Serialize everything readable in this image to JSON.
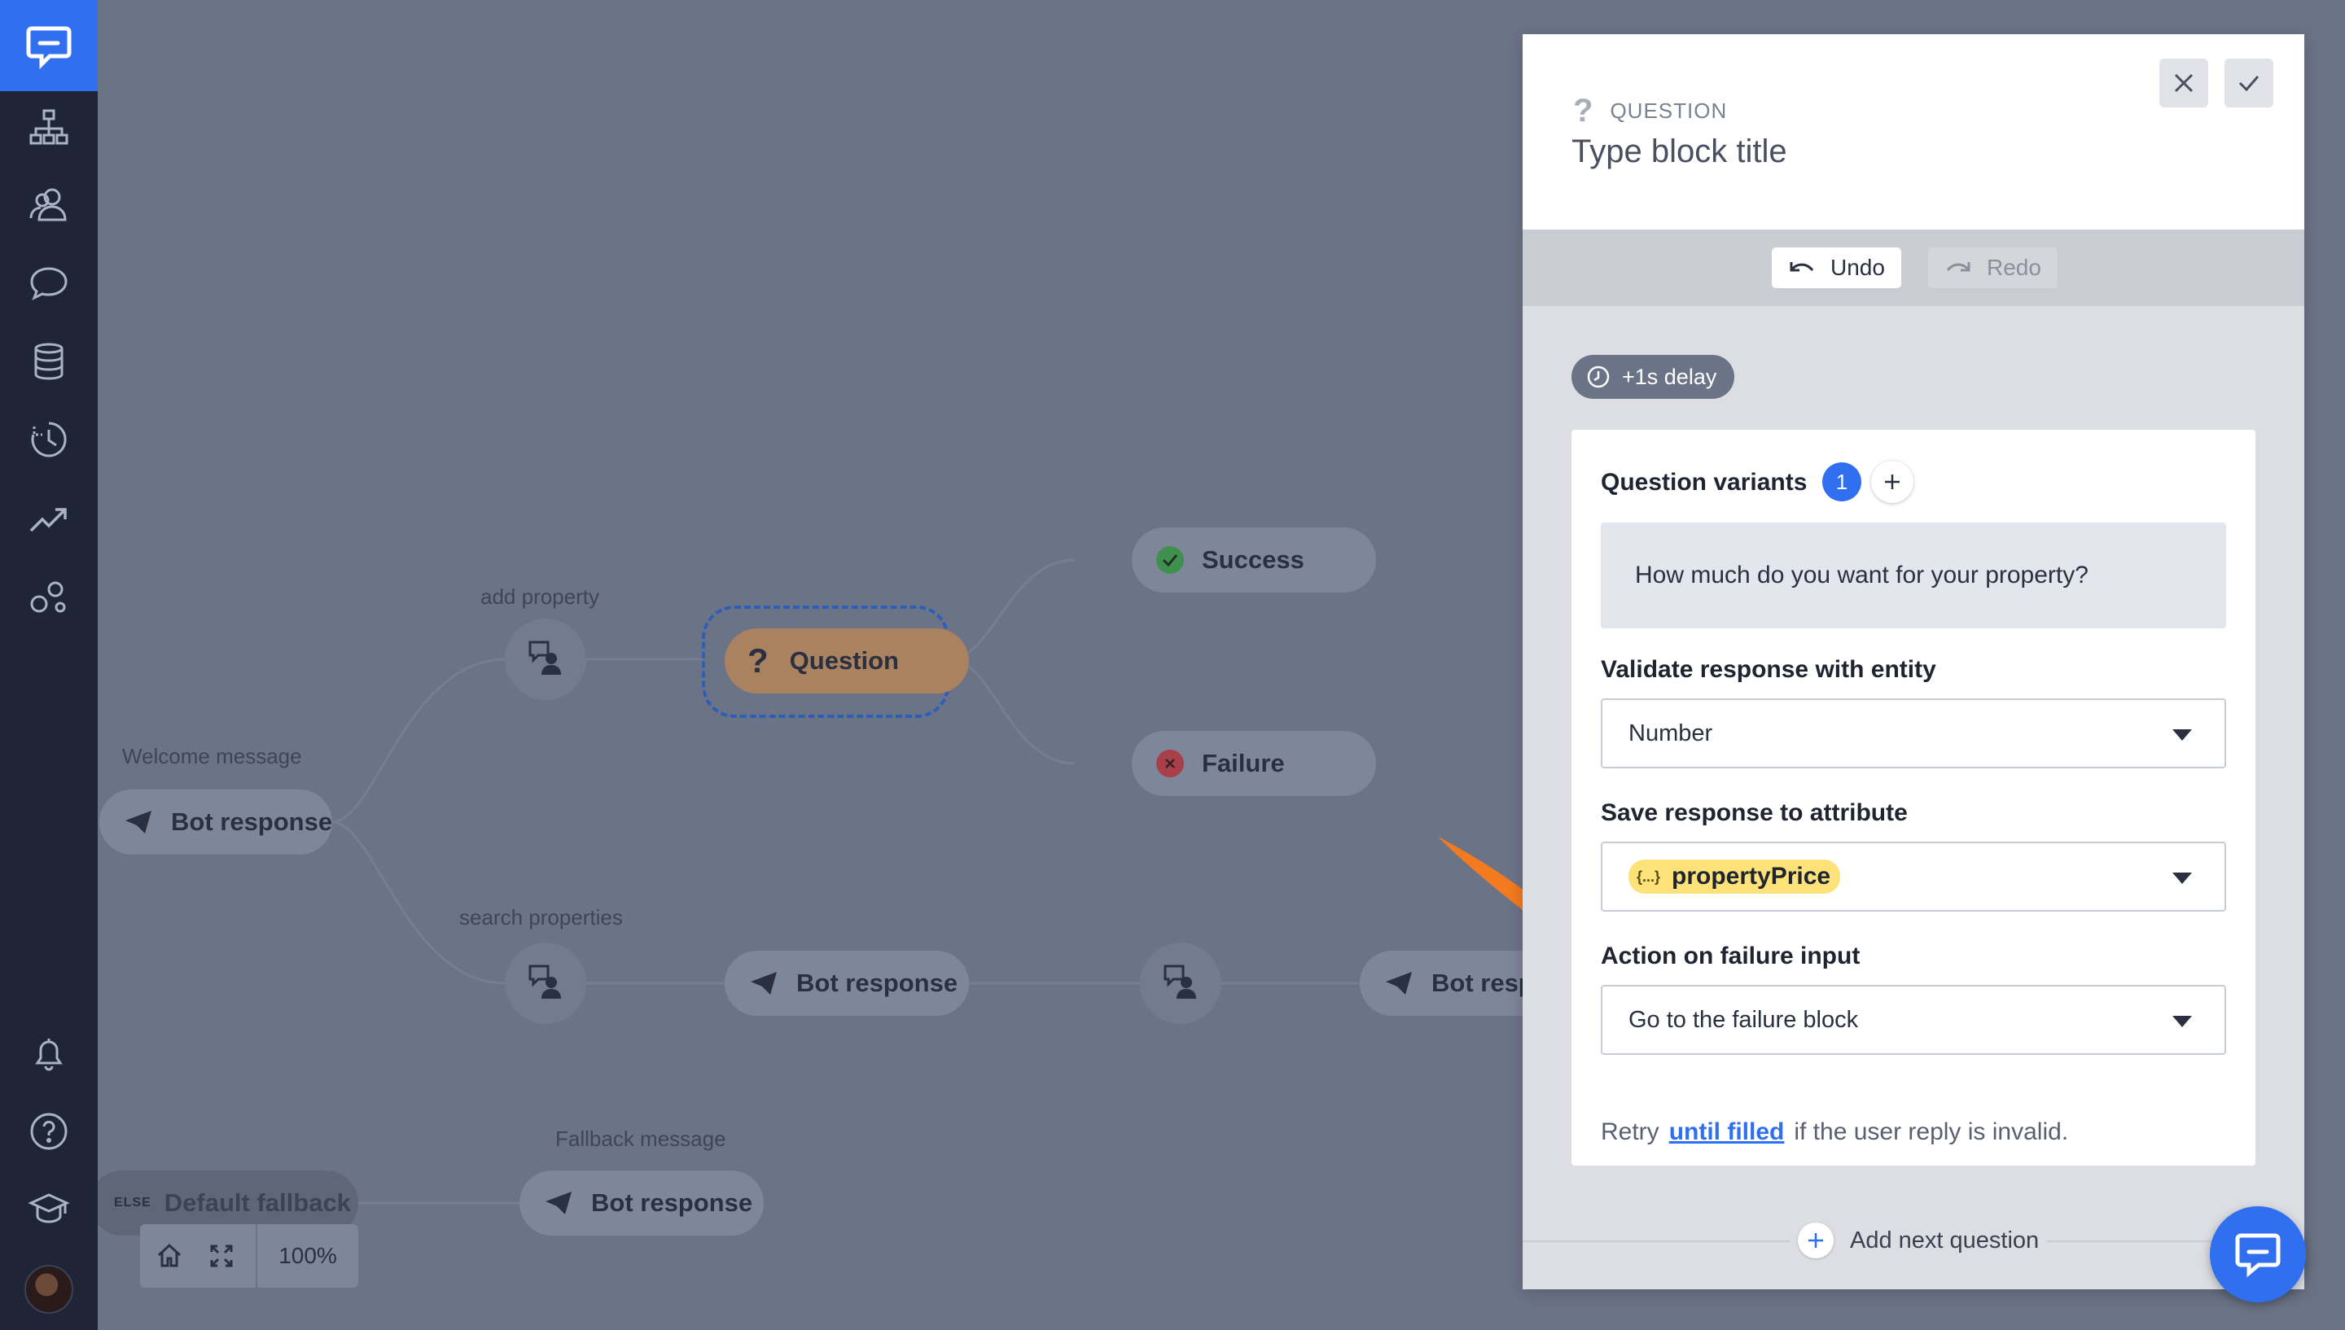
{
  "canvas": {
    "labels": {
      "welcome": "Welcome message",
      "add_property": "add property",
      "search_properties": "search properties",
      "fallback": "Fallback message"
    },
    "nodes": {
      "welcome_bot": "Bot response",
      "question": "Question",
      "success": "Success",
      "failure": "Failure",
      "search_bot": "Bot response",
      "search_bot2": "Bot resp",
      "fallback_bot": "Bot response",
      "default_fallback": "Default fallback",
      "else_tag": "ELSE"
    },
    "zoom": "100%"
  },
  "panel": {
    "kind": "QUESTION",
    "title_placeholder": "Type block title",
    "undo": "Undo",
    "redo": "Redo",
    "delay": "+1s delay",
    "variants_label": "Question variants",
    "variants_count": "1",
    "variant_text": "How much do you want for your property?",
    "validate_label": "Validate response with entity",
    "validate_value": "Number",
    "save_label": "Save response to attribute",
    "save_brace": "{...}",
    "save_value": "propertyPrice",
    "failure_label": "Action on failure input",
    "failure_value": "Go to the failure block",
    "retry_prefix": "Retry",
    "retry_link": "until filled",
    "retry_suffix": "if the user reply is invalid.",
    "add_next": "Add next question"
  },
  "colors": {
    "accent": "#2f6ff0",
    "sidebar": "#1f2537",
    "canvas": "#6b7487",
    "success": "#3f8f4f",
    "failure": "#a8404a",
    "arrow": "#f47a1f",
    "attribute_chip": "#fde27a"
  },
  "icons": [
    "logo-icon",
    "flow-icon",
    "users-icon",
    "chat-icon",
    "database-icon",
    "history-icon",
    "analytics-icon",
    "integrations-icon",
    "bell-icon",
    "help-icon",
    "academy-icon"
  ]
}
